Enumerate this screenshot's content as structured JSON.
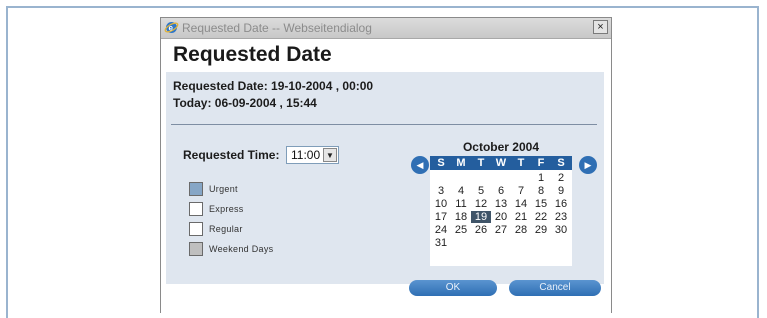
{
  "window": {
    "title": "Requested Date -- Webseitendialog",
    "close_label": "×"
  },
  "heading": "Requested Date",
  "info": {
    "requested": "Requested Date:  19-10-2004 , 00:00",
    "today": "Today:  06-09-2004 , 15:44"
  },
  "time": {
    "label": "Requested Time:",
    "value": "11:00"
  },
  "legend": [
    {
      "label": "Urgent",
      "color": "#86a6c6"
    },
    {
      "label": "Express",
      "color": "#ffffff"
    },
    {
      "label": "Regular",
      "color": "#ffffff"
    },
    {
      "label": "Weekend Days",
      "color": "#bfbfbf"
    }
  ],
  "calendar": {
    "month_label": "October 2004",
    "weekdays": [
      "S",
      "M",
      "T",
      "W",
      "T",
      "F",
      "S"
    ],
    "weeks": [
      [
        "",
        "",
        "",
        "",
        "",
        "1",
        "2"
      ],
      [
        "3",
        "4",
        "5",
        "6",
        "7",
        "8",
        "9"
      ],
      [
        "10",
        "11",
        "12",
        "13",
        "14",
        "15",
        "16"
      ],
      [
        "17",
        "18",
        "19",
        "20",
        "21",
        "22",
        "23"
      ],
      [
        "24",
        "25",
        "26",
        "27",
        "28",
        "29",
        "30"
      ],
      [
        "31",
        "",
        "",
        "",
        "",
        "",
        ""
      ]
    ],
    "selected_day": "19"
  },
  "buttons": {
    "ok": "OK",
    "cancel": "Cancel"
  },
  "colors": {
    "accent": "#2f6fb4",
    "panel": "#dfe6ef"
  }
}
